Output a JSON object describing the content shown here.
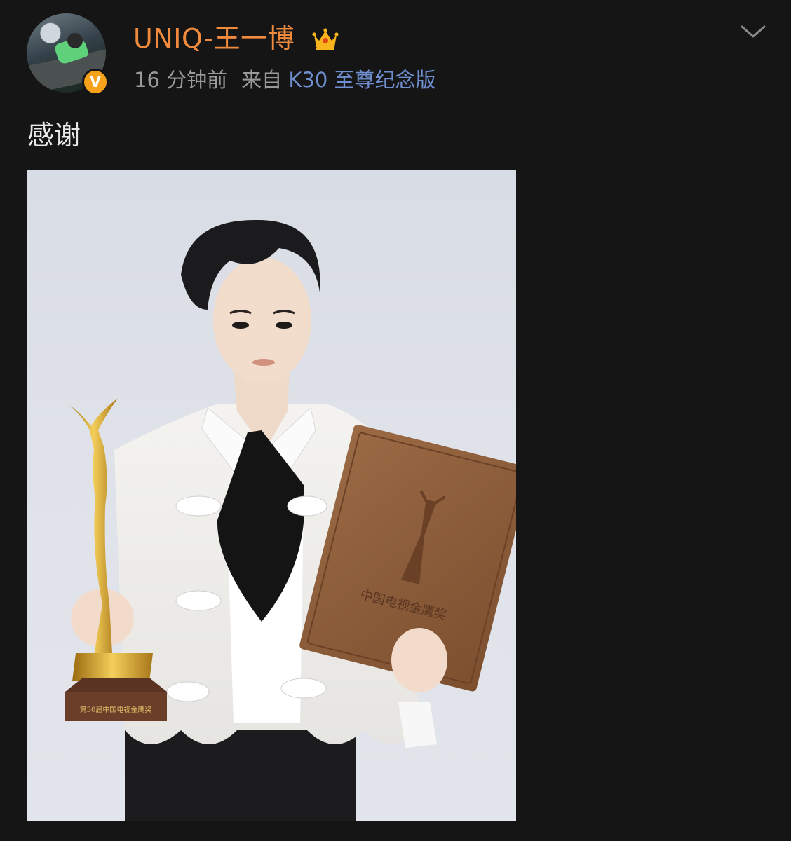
{
  "post": {
    "username": "UNIQ-王一博",
    "verified_badge": "V",
    "timestamp": "16 分钟前",
    "source_prefix": "来自",
    "source_device": "K30 至尊纪念版",
    "text": "感谢",
    "trophy_plaque": "第30届中国电视金鹰奖",
    "certificate_title": "中国电视金鹰奖"
  },
  "icons": {
    "member": "crown-icon",
    "menu": "chevron-down-icon",
    "verified": "verified-v-icon"
  },
  "colors": {
    "background": "#151515",
    "username": "#f08a3c",
    "meta": "#9a9a9a",
    "device_link": "#6f8fd0",
    "body_text": "#e8e8e8",
    "verified_badge": "#f7a21b",
    "crown": "#f7b51b"
  }
}
